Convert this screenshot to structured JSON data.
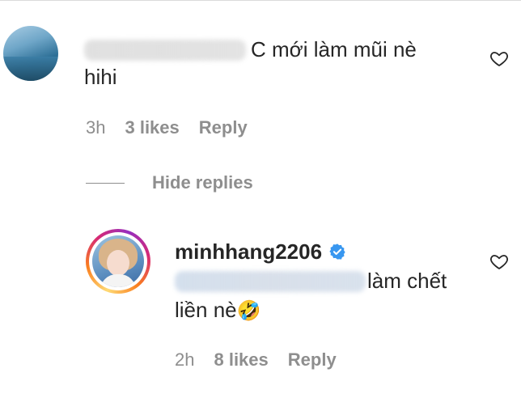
{
  "comment": {
    "text_line1": "C mới làm mũi nè",
    "text_line2": "hihi",
    "time": "3h",
    "likes": "3 likes",
    "reply_label": "Reply"
  },
  "hide_replies_label": "Hide replies",
  "reply": {
    "username": "minhhang2206",
    "text_part1": "làm chết",
    "text_line2": "liền nè",
    "emoji": "🤣",
    "time": "2h",
    "likes": "8 likes",
    "reply_label": "Reply"
  },
  "colors": {
    "text": "#262626",
    "secondary": "#8e8e8e",
    "verified_blue": "#3897f0"
  }
}
